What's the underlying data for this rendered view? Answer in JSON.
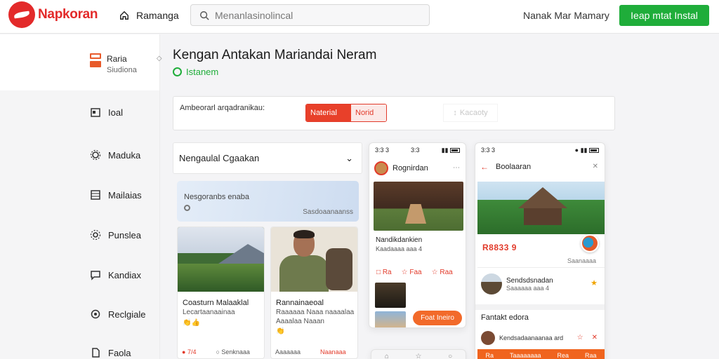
{
  "header": {
    "brand": "Napkoran",
    "home_label": "Ramanga",
    "search_placeholder": "Menanlasinolincal",
    "account_link": "Nanak Mar Mamary",
    "cta_label": "Ieap mtat Instal"
  },
  "sidebar": {
    "profile": {
      "name": "Raria",
      "sub": "Siudiona"
    },
    "items": [
      {
        "label": "Ioal",
        "icon": "calendar-icon"
      },
      {
        "label": "Maduka",
        "icon": "gear-icon"
      },
      {
        "label": "Mailaias",
        "icon": "grid-icon"
      },
      {
        "label": "Punslea",
        "icon": "gear-icon"
      },
      {
        "label": "Kandiax",
        "icon": "chat-icon"
      },
      {
        "label": "Reclgiale",
        "icon": "settings-icon"
      },
      {
        "label": "Faola",
        "icon": "page-icon"
      }
    ]
  },
  "main": {
    "title": "Kengan Antakan Mariandai Neram",
    "status": "Istanem",
    "filter": {
      "label": "Ambeorarl arqadranikau:",
      "seg_on": "Naterial",
      "seg_off": "Norid",
      "ghost": "Kacaoty"
    }
  },
  "feed": {
    "heading": "Nengaulal Cgaakan",
    "banner_text": "Nesgoranbs enaba",
    "banner_link": "Sasdoaanaanss",
    "posts": [
      {
        "title": "Coasturn Malaaklal",
        "sub": "Lecartaanaainaa",
        "emoji": "👏👍",
        "likes": "7/4",
        "comments": "Senknaaa",
        "image": "mountain"
      },
      {
        "title": "Rannainaeoal",
        "sub": "Raaaaaa Naaa naaaalaa",
        "sub2": "Aaaalaa Naaan",
        "emoji": "👏",
        "likes": "Aaaaaaa",
        "comments": "Naanaaa",
        "image": "person"
      }
    ]
  },
  "phone1": {
    "time": "3:3 3",
    "carrier": "3:3",
    "user": "Rognirdan",
    "caption": "Nandikdankien",
    "caption2": "Kaadaaaa aaa 4",
    "actions": [
      "Ra",
      "Faa",
      "Raa"
    ],
    "button": "Foat Ineiro"
  },
  "phone2": {
    "time": "3:3 3",
    "title": "Boolaaran",
    "price": "R8833 9",
    "more": "Saanaaaa",
    "host_name": "Sendsdsnadan",
    "host_sub": "Saaaaaa aaa 4",
    "section": "Fantakt edora",
    "row_text": "Kendsadaanaanaa ard",
    "bottom_items": [
      "Ra",
      "Taaaaaaaa",
      "Rea",
      "Raa"
    ]
  },
  "colors": {
    "brand_red": "#e32a2a",
    "cta_green": "#1fad3a",
    "accent_orange": "#f26a2a"
  }
}
